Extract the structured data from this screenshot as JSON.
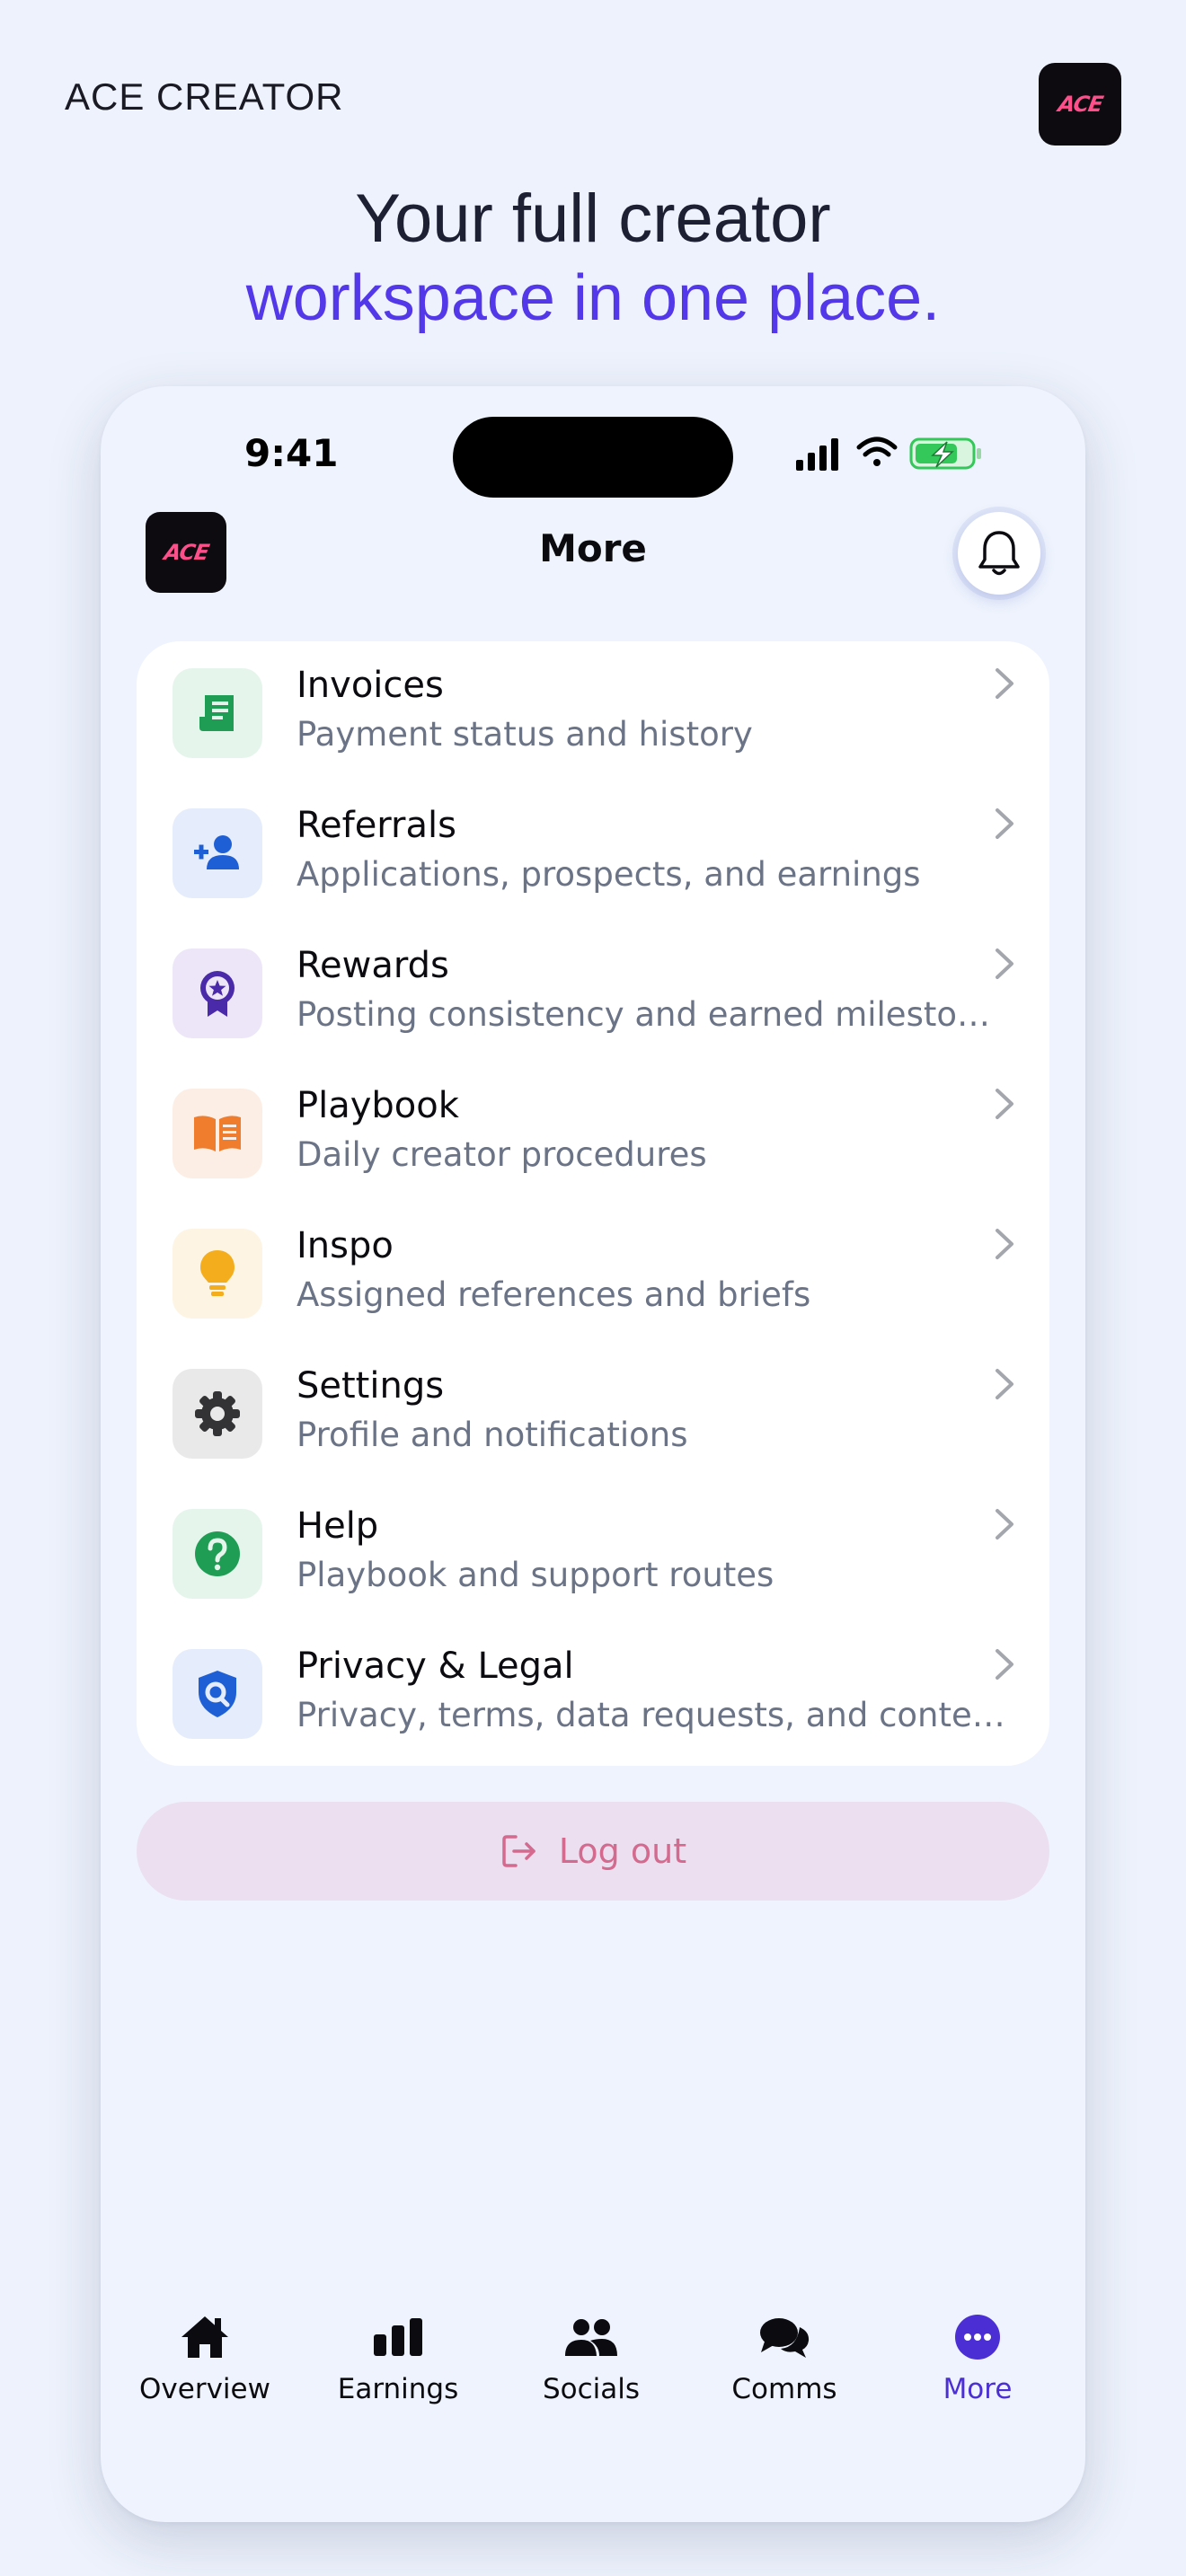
{
  "brand": {
    "name": "ACE CREATOR",
    "logo_text": "ACE"
  },
  "headline": {
    "line1": "Your full creator",
    "line2": "workspace in one place."
  },
  "status_bar": {
    "time": "9:41"
  },
  "header": {
    "title": "More",
    "logo_text": "ACE"
  },
  "colors": {
    "accent": "#5338ea",
    "logo_pink": "#ff4f8b",
    "logout_text": "#d46a8e",
    "logout_bg": "#ebdff0",
    "battery_green": "#34c759"
  },
  "menu": {
    "items": [
      {
        "title": "Invoices",
        "subtitle": "Payment status and history",
        "icon": "receipt-icon",
        "icon_bg": "#e6f5ec",
        "icon_color": "#1f9d55"
      },
      {
        "title": "Referrals",
        "subtitle": "Applications, prospects, and earnings",
        "icon": "person-add-icon",
        "icon_bg": "#e5ecfb",
        "icon_color": "#1e5fd6"
      },
      {
        "title": "Rewards",
        "subtitle": "Posting consistency and earned milestones",
        "icon": "badge-icon",
        "icon_bg": "#ece6f8",
        "icon_color": "#4a2aa8"
      },
      {
        "title": "Playbook",
        "subtitle": "Daily creator procedures",
        "icon": "book-icon",
        "icon_bg": "#fdeee5",
        "icon_color": "#ef7d2d"
      },
      {
        "title": "Inspo",
        "subtitle": "Assigned references and briefs",
        "icon": "lightbulb-icon",
        "icon_bg": "#fdf4e3",
        "icon_color": "#f4ad1c"
      },
      {
        "title": "Settings",
        "subtitle": "Profile and notifications",
        "icon": "gear-icon",
        "icon_bg": "#e9e9ea",
        "icon_color": "#333336"
      },
      {
        "title": "Help",
        "subtitle": "Playbook and support routes",
        "icon": "help-icon",
        "icon_bg": "#e6f5ec",
        "icon_color": "#1f9d55"
      },
      {
        "title": "Privacy & Legal",
        "subtitle": "Privacy, terms, data requests, and content s...",
        "icon": "shield-search-icon",
        "icon_bg": "#e5ecfb",
        "icon_color": "#1e5fd6"
      }
    ]
  },
  "logout": {
    "label": "Log out"
  },
  "tabs": [
    {
      "label": "Overview",
      "icon": "home-icon"
    },
    {
      "label": "Earnings",
      "icon": "bar-chart-icon"
    },
    {
      "label": "Socials",
      "icon": "people-icon"
    },
    {
      "label": "Comms",
      "icon": "chat-icon"
    },
    {
      "label": "More",
      "icon": "more-icon",
      "active": true
    }
  ]
}
